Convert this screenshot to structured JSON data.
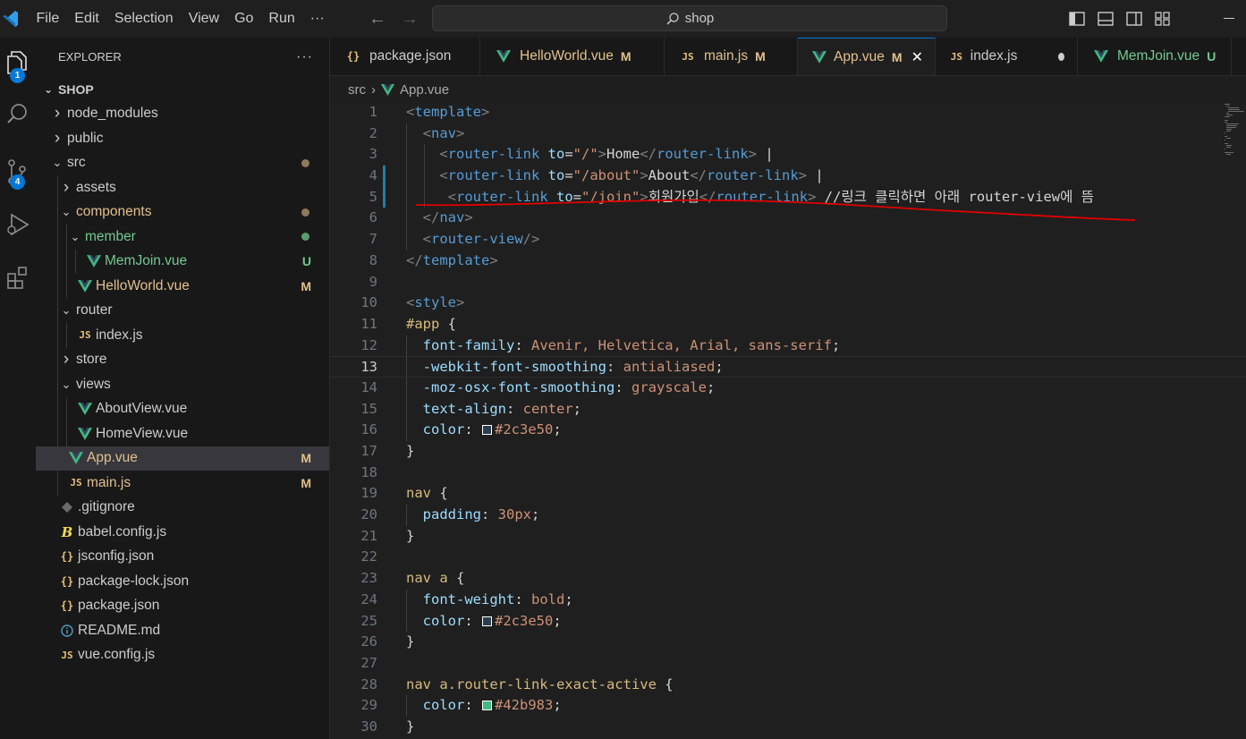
{
  "menu": [
    "File",
    "Edit",
    "Selection",
    "View",
    "Go",
    "Run",
    "···"
  ],
  "search": {
    "text": "shop"
  },
  "activity": {
    "explorer_badge": "1",
    "scm_badge": "4"
  },
  "explorer": {
    "title": "EXPLORER",
    "more": "···",
    "root": "SHOP",
    "items": [
      {
        "label": "node_modules",
        "type": "folder",
        "open": false,
        "depth": 1
      },
      {
        "label": "public",
        "type": "folder",
        "open": false,
        "depth": 1
      },
      {
        "label": "src",
        "type": "folder",
        "open": true,
        "depth": 1,
        "dot": "#8d7a5b"
      },
      {
        "label": "assets",
        "type": "folder",
        "open": false,
        "depth": 2
      },
      {
        "label": "components",
        "type": "folder",
        "open": true,
        "depth": 2,
        "tint": "mod",
        "dot": "#8d7a5b"
      },
      {
        "label": "member",
        "type": "folder",
        "open": true,
        "depth": 3,
        "tint": "new",
        "dot": "#5a9e6f"
      },
      {
        "label": "MemJoin.vue",
        "type": "vue",
        "depth": 4,
        "tint": "new",
        "status": "U"
      },
      {
        "label": "HelloWorld.vue",
        "type": "vue",
        "depth": 3,
        "tint": "mod",
        "status": "M"
      },
      {
        "label": "router",
        "type": "folder",
        "open": true,
        "depth": 2
      },
      {
        "label": "index.js",
        "type": "js",
        "depth": 3
      },
      {
        "label": "store",
        "type": "folder",
        "open": false,
        "depth": 2
      },
      {
        "label": "views",
        "type": "folder",
        "open": true,
        "depth": 2
      },
      {
        "label": "AboutView.vue",
        "type": "vue",
        "depth": 3
      },
      {
        "label": "HomeView.vue",
        "type": "vue",
        "depth": 3
      },
      {
        "label": "App.vue",
        "type": "vue",
        "depth": 2,
        "tint": "mod",
        "status": "M",
        "selected": true
      },
      {
        "label": "main.js",
        "type": "js",
        "depth": 2,
        "tint": "mod",
        "status": "M"
      },
      {
        "label": ".gitignore",
        "type": "git",
        "depth": 1
      },
      {
        "label": "babel.config.js",
        "type": "babel",
        "depth": 1
      },
      {
        "label": "jsconfig.json",
        "type": "json",
        "depth": 1
      },
      {
        "label": "package-lock.json",
        "type": "json",
        "depth": 1
      },
      {
        "label": "package.json",
        "type": "json",
        "depth": 1
      },
      {
        "label": "README.md",
        "type": "info",
        "depth": 1
      },
      {
        "label": "vue.config.js",
        "type": "js",
        "depth": 1
      }
    ]
  },
  "tabs": [
    {
      "label": "package.json",
      "type": "json"
    },
    {
      "label": "HelloWorld.vue",
      "type": "vue",
      "status": "M",
      "tint": "mod"
    },
    {
      "label": "main.js",
      "type": "js",
      "status": "M",
      "tint": "mod"
    },
    {
      "label": "App.vue",
      "type": "vue",
      "status": "M",
      "tint": "mod",
      "active": true
    },
    {
      "label": "index.js",
      "type": "js",
      "dirty": true
    },
    {
      "label": "MemJoin.vue",
      "type": "vue",
      "status": "U",
      "tint": "new"
    }
  ],
  "breadcrumb": {
    "folder": "src",
    "file": "App.vue"
  },
  "editor": {
    "current_line": 13,
    "lines": [
      "<template>",
      "  <nav>",
      "    <router-link to=\"/\">Home</router-link> |",
      "    <router-link to=\"/about\">About</router-link> |",
      "     <router-link to=\"/join\">회원가입</router-link> //링크 클릭하면 아래 router-view에 뜸",
      "  </nav>",
      "  <router-view/>",
      "</template>",
      "",
      "<style>",
      "#app {",
      "  font-family: Avenir, Helvetica, Arial, sans-serif;",
      "  -webkit-font-smoothing: antialiased;",
      "  -moz-osx-font-smoothing: grayscale;",
      "  text-align: center;",
      "  color: #2c3e50;",
      "}",
      "",
      "nav {",
      "  padding: 30px;",
      "}",
      "",
      "nav a {",
      "  font-weight: bold;",
      "  color: #2c3e50;",
      "}",
      "",
      "nav a.router-link-exact-active {",
      "  color: #42b983;",
      "}"
    ]
  },
  "colors": {
    "tag": "#569cd6",
    "attr": "#9cdcfe",
    "string": "#ce9178",
    "selector": "#d7ba7d",
    "property": "#9cdcfe",
    "value": "#ce9178",
    "vue_green": "#41b883",
    "annotation": "#e00000"
  }
}
